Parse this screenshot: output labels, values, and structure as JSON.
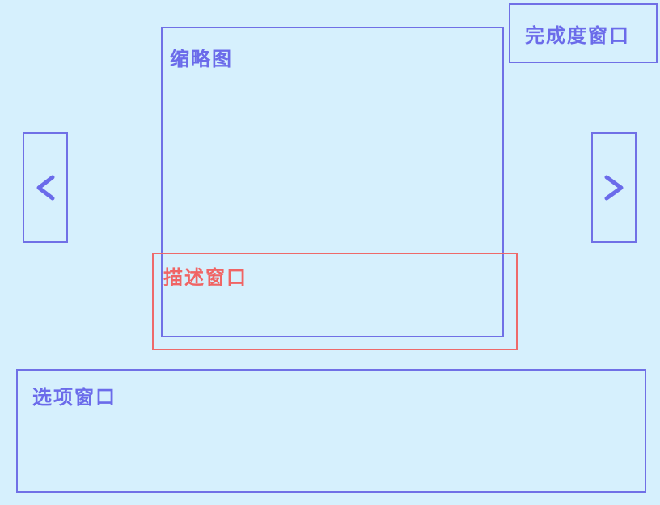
{
  "completion_window": {
    "label": "完成度窗口"
  },
  "thumbnail": {
    "label": "缩略图"
  },
  "description_window": {
    "label": "描述窗口"
  },
  "options_window": {
    "label": "选项窗口"
  },
  "nav": {
    "prev_icon": "chevron-left-icon",
    "next_icon": "chevron-right-icon"
  },
  "colors": {
    "background": "#d6f0fd",
    "frame": "#7070e6",
    "label": "#6b6bea",
    "description_frame": "#ee6a6a",
    "description_label": "#f06464"
  }
}
